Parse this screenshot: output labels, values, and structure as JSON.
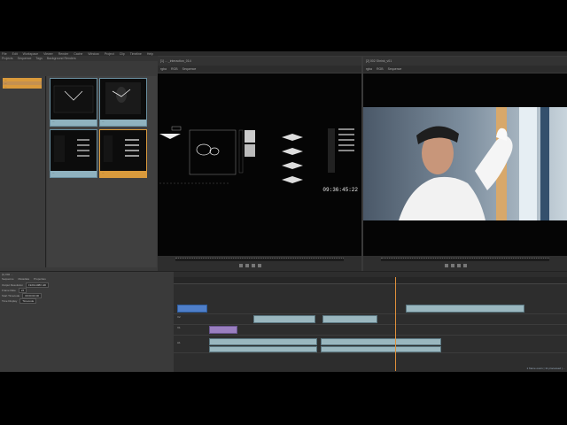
{
  "app": {
    "menu": [
      "File",
      "Edit",
      "Workspace",
      "Viewer",
      "Render",
      "Cache",
      "Window",
      "Project",
      "Clip",
      "Timeline",
      "Help"
    ],
    "toolbar": [
      "Projects",
      "Sequence",
      "Tags",
      "Background Renders"
    ]
  },
  "bin": {
    "items": [
      "...",
      "...",
      "..."
    ]
  },
  "browser": {
    "thumbs": [
      {
        "caption": "...",
        "style": "blue"
      },
      {
        "caption": "...",
        "style": "blue"
      },
      {
        "caption": "...",
        "style": "blue"
      },
      {
        "caption": "...",
        "style": "orange"
      }
    ]
  },
  "viewer_left": {
    "tab": "[1] ... _interaction_014",
    "controls": [
      "rgba",
      "RGB",
      "Sequence"
    ],
    "timecode": "09:36:45:22"
  },
  "viewer_right": {
    "tab": "[2] 002 Shrink_v01",
    "controls": [
      "rgba",
      "RGB",
      "Sequence"
    ]
  },
  "lower_left": {
    "tabs": [
      "Sequence",
      "Metadata",
      "Properties"
    ],
    "rows": [
      {
        "label": "Output Resolution",
        "value": "1920x1080 HD"
      },
      {
        "label": "Frame Rate",
        "value": "24"
      },
      {
        "label": "Start Timecode",
        "value": "00:00:00:00"
      },
      {
        "label": "Time Display",
        "value": "Timecode"
      }
    ]
  },
  "timeline": {
    "tab": "[1] 002 ...",
    "tracks": [
      "V3",
      "V2",
      "V1",
      "A1"
    ],
    "status": "1 frame overs | 11 processed | ..."
  },
  "colors": {
    "clip": "#9ab7bf",
    "clip_purple": "#9a7fc0",
    "clip_blue": "#4f7fc9",
    "playhead": "#e0903a",
    "bin_selected": "#d99a3c"
  }
}
